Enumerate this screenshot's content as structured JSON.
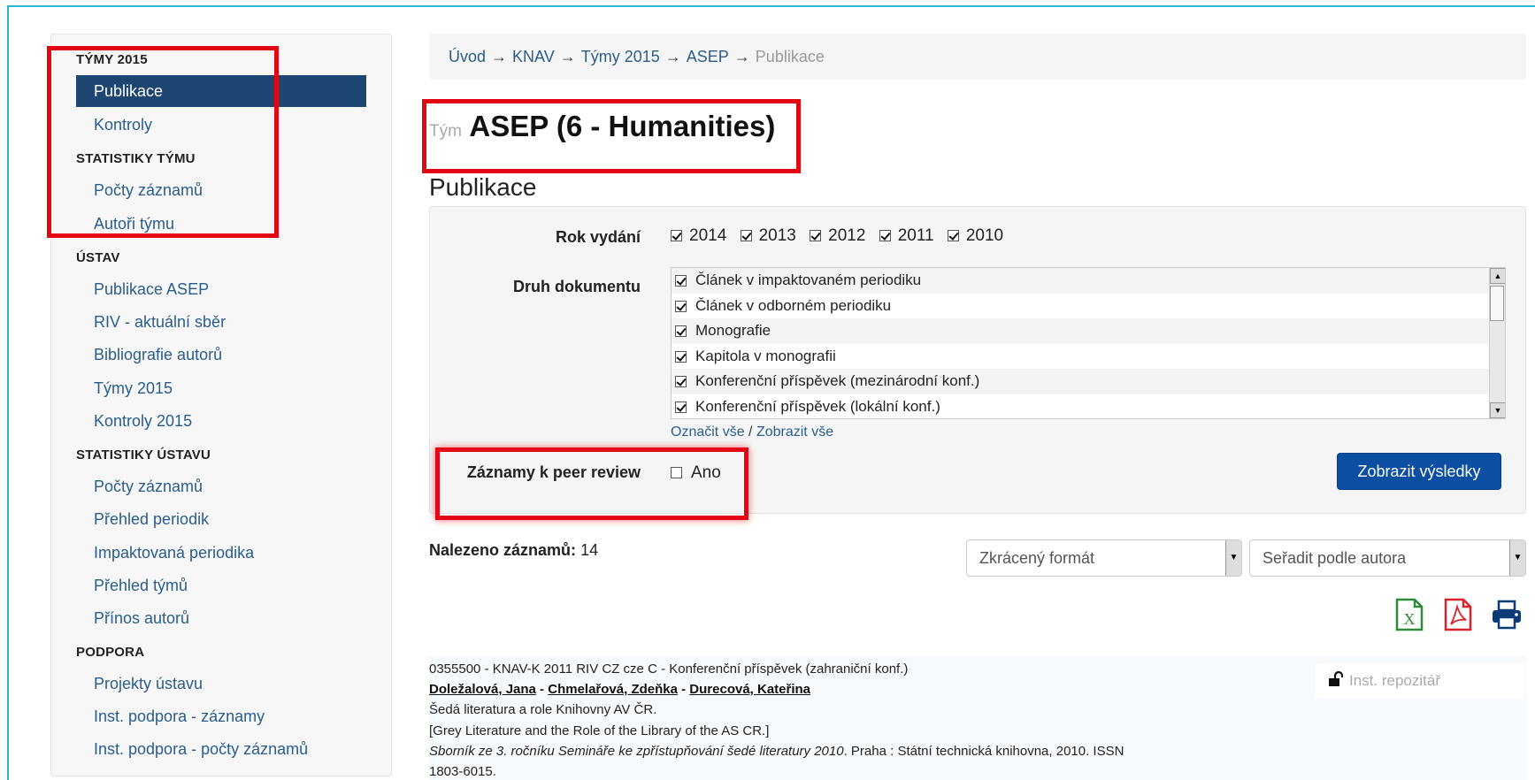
{
  "sidebar": {
    "sections": [
      {
        "header": "Týmy 2015",
        "items": [
          "Publikace",
          "Kontroly"
        ]
      },
      {
        "header": "Statistiky týmu",
        "items": [
          "Počty záznamů",
          "Autoři týmu"
        ]
      },
      {
        "header": "Ústav",
        "items": [
          "Publikace ASEP",
          "RIV - aktuální sběr",
          "Bibliografie autorů",
          "Týmy 2015",
          "Kontroly 2015"
        ]
      },
      {
        "header": "Statistiky ústavu",
        "items": [
          "Počty záznamů",
          "Přehled periodik",
          "Impaktovaná periodika",
          "Přehled týmů",
          "Přínos autorů"
        ]
      },
      {
        "header": "Podpora",
        "items": [
          "Projekty ústavu",
          "Inst. podpora - záznamy",
          "Inst. podpora - počty záznamů"
        ]
      }
    ],
    "active_item": "Publikace"
  },
  "breadcrumb": {
    "items": [
      "Úvod",
      "KNAV",
      "Týmy 2015",
      "ASEP"
    ],
    "current": "Publikace",
    "separator": "→"
  },
  "team_title": {
    "prefix": "Tým",
    "name": "ASEP (6 - Humanities)"
  },
  "section_title": "Publikace",
  "filters": {
    "year_label": "Rok vydání",
    "years": [
      "2014",
      "2013",
      "2012",
      "2011",
      "2010"
    ],
    "doc_type_label": "Druh dokumentu",
    "doc_types": [
      "Článek v impaktovaném periodiku",
      "Článek v odborném periodiku",
      "Monografie",
      "Kapitola v monografii",
      "Konferenční příspěvek (mezinárodní konf.)",
      "Konferenční příspěvek (lokální konf.)"
    ],
    "select_all": "Označit vše",
    "show_all": "Zobrazit vše",
    "link_separator": "/",
    "peer_review_label": "Záznamy k peer review",
    "peer_review_option": "Ano",
    "submit_label": "Zobrazit výsledky"
  },
  "results": {
    "found_label": "Nalezeno záznamů:",
    "found_count": "14",
    "format_select": "Zkrácený formát",
    "sort_select": "Seřadit podle autora",
    "export_icons": [
      "excel-icon",
      "pdf-icon",
      "print-icon"
    ]
  },
  "record": {
    "line1": "0355500 - KNAV-K 2011 RIV CZ cze C - Konferenční příspěvek (zahraniční konf.)",
    "authors": [
      "Doležalová, Jana",
      "Chmelařová, Zdeňka",
      "Durecová, Kateřina"
    ],
    "author_separator": " - ",
    "title_cs": "Šedá literatura a role Knihovny AV ČR.",
    "title_en": "[Grey Literature and the Role of the Library of the AS CR.]",
    "source_italic": "Sborník ze 3. ročníku Semináře ke zpřístupňování šedé literatury 2010",
    "source_rest": ". Praha : Státní technická knihovna, 2010. ISSN",
    "issn": "1803-6015.",
    "repo_label": "Inst. repozitář"
  },
  "colors": {
    "accent": "#1e4672",
    "link": "#2b5d8c",
    "button": "#0b4ea2",
    "highlight": "#e30613",
    "frame": "#29b6d8"
  }
}
